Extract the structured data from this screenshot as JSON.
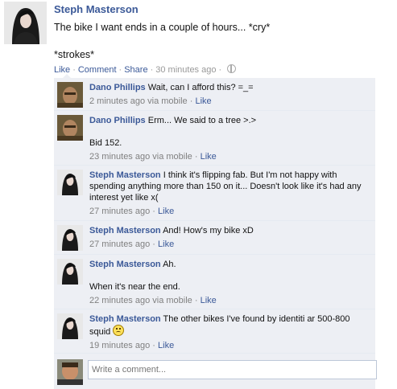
{
  "post": {
    "author": "Steph Masterson",
    "text": "The bike I want ends in a couple of hours... *cry*\n\n*strokes*",
    "actions": {
      "like": "Like",
      "comment": "Comment",
      "share": "Share",
      "time": "30 minutes ago"
    }
  },
  "comments": [
    {
      "author": "Dano Phillips",
      "text": "Wait, can I afford this? =_=",
      "time": "2 minutes ago via mobile",
      "like": "Like"
    },
    {
      "author": "Dano Phillips",
      "text": "Erm... We said to a tree >.>\n\nBid 152.",
      "time": "23 minutes ago via mobile",
      "like": "Like"
    },
    {
      "author": "Steph Masterson",
      "text": "I think it's flipping fab. But I'm not happy with spending anything more than 150 on it... Doesn't look like it's had any interest yet like x(",
      "time": "27 minutes ago",
      "like": "Like"
    },
    {
      "author": "Steph Masterson",
      "text": "And! How's my bike xD",
      "time": "27 minutes ago",
      "like": "Like"
    },
    {
      "author": "Steph Masterson",
      "text": "Ah.\n\nWhen it's near the end.",
      "time": "22 minutes ago via mobile",
      "like": "Like"
    },
    {
      "author": "Steph Masterson",
      "text": "The other bikes I've found by identiti ar 500-800 squid",
      "time": "19 minutes ago",
      "like": "Like"
    }
  ],
  "reply": {
    "placeholder": "Write a comment..."
  },
  "separator": "·",
  "colors": {
    "link": "#3b5998",
    "comment_bg": "#edeff4",
    "meta": "#999999"
  },
  "icons": {
    "audience": "globe-icon",
    "emoticon": "frown-emoticon-icon"
  }
}
